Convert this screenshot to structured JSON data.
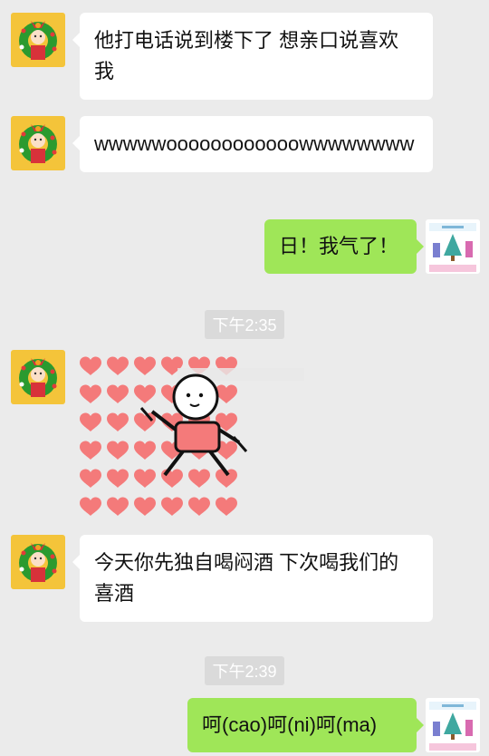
{
  "messages": [
    {
      "text": "他打电话说到楼下了 想亲口说喜欢我"
    },
    {
      "text": "wwwwwoooooooooooowwwwwwww"
    },
    {
      "text": "日！我气了！"
    },
    {
      "text": "今天你先独自喝闷酒 下次喝我们的喜酒"
    },
    {
      "text": "呵(cao)呵(ni)呵(ma)"
    }
  ],
  "timestamps": [
    "下午2:35",
    "下午2:39"
  ],
  "colors": {
    "background": "#ebebeb",
    "incoming_bubble": "#ffffff",
    "outgoing_bubble": "#9fe658",
    "timestamp_bg": "#dadada",
    "heart": "#f47a7a"
  },
  "icons": {
    "left_avatar": "christmas-wreath-icon",
    "right_avatar": "christmas-card-icon",
    "sticker": "hearts-dancing-figure"
  }
}
